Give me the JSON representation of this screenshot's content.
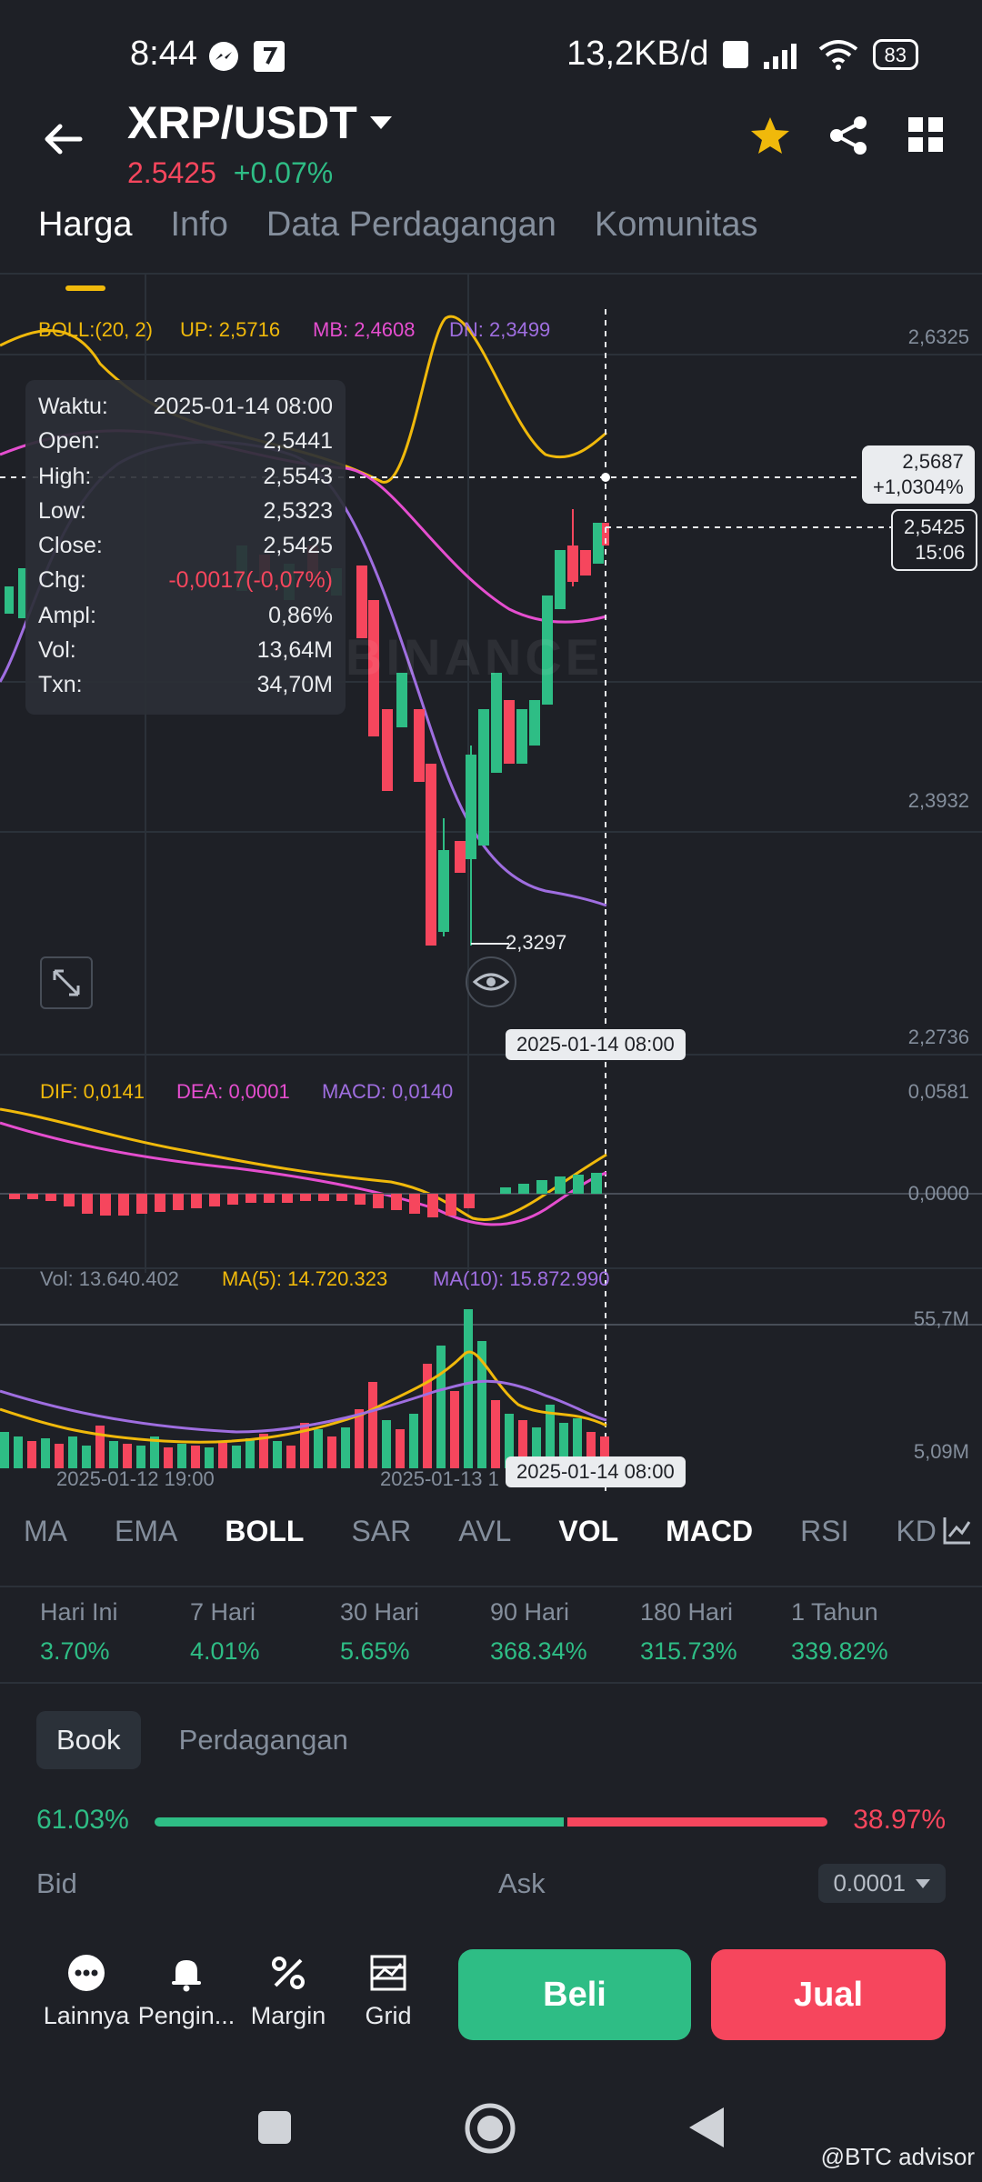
{
  "status_bar": {
    "time": "8:44",
    "net_speed": "13,2KB/d",
    "battery": "83"
  },
  "header": {
    "pair": "XRP/USDT",
    "price": "2.5425",
    "change": "+0.07%"
  },
  "tabs": [
    "Harga",
    "Info",
    "Data Perdagangan",
    "Komunitas"
  ],
  "boll": {
    "label": "BOLL:(20, 2)",
    "up": "UP: 2,5716",
    "mb": "MB: 2,4608",
    "dn": "DN: 2,3499"
  },
  "price_axis": [
    "2,6325",
    "2,3932",
    "2,2736"
  ],
  "tooltip": [
    {
      "k": "Waktu:",
      "v": "2025-01-14 08:00"
    },
    {
      "k": "Open:",
      "v": "2,5441"
    },
    {
      "k": "High:",
      "v": "2,5543"
    },
    {
      "k": "Low:",
      "v": "2,5323"
    },
    {
      "k": "Close:",
      "v": "2,5425"
    },
    {
      "k": "Chg:",
      "v": "-0,0017(-0,07%)"
    },
    {
      "k": "Ampl:",
      "v": "0,86%"
    },
    {
      "k": "Vol:",
      "v": "13,64M"
    },
    {
      "k": "Txn:",
      "v": "34,70M"
    }
  ],
  "cross_price": {
    "value": "2,5687",
    "pct": "+1,0304%"
  },
  "last_price": {
    "value": "2,5425",
    "countdown": "15:06"
  },
  "low_marker": "2,3297",
  "cross_date": "2025-01-14 08:00",
  "watermark": "BINANCE",
  "macd": {
    "dif": "DIF: 0,0141",
    "dea": "DEA: 0,0001",
    "macd": "MACD: 0,0140",
    "axis_top": "0,0581",
    "axis_zero": "0,0000"
  },
  "volume": {
    "vol": "Vol: 13.640.402",
    "ma5": "MA(5): 14.720.323",
    "ma10": "MA(10): 15.872.990",
    "axis_top": "55,7M",
    "axis_bottom": "5,09M"
  },
  "time_axis": [
    "2025-01-12 19:00",
    "2025-01-13 1"
  ],
  "indicator_tabs": [
    "MA",
    "EMA",
    "BOLL",
    "SAR",
    "AVL",
    "VOL",
    "MACD",
    "RSI",
    "KD"
  ],
  "performance": [
    {
      "label": "Hari Ini",
      "value": "3.70%"
    },
    {
      "label": "7 Hari",
      "value": "4.01%"
    },
    {
      "label": "30 Hari",
      "value": "5.65%"
    },
    {
      "label": "90 Hari",
      "value": "368.34%"
    },
    {
      "label": "180 Hari",
      "value": "315.73%"
    },
    {
      "label": "1 Tahun",
      "value": "339.82%"
    }
  ],
  "book_tabs": [
    "Book",
    "Perdagangan"
  ],
  "book_ratio": {
    "bid": "61.03%",
    "ask": "38.97%"
  },
  "bid_label": "Bid",
  "ask_label": "Ask",
  "precision": "0.0001",
  "actions": [
    "Lainnya",
    "Pengin...",
    "Margin",
    "Grid"
  ],
  "buy_label": "Beli",
  "sell_label": "Jual",
  "credit": "@BTC advisor",
  "colors": {
    "up": "#2ebd85",
    "down": "#f6465d",
    "accent": "#f0b90b",
    "bg": "#1e2026"
  }
}
